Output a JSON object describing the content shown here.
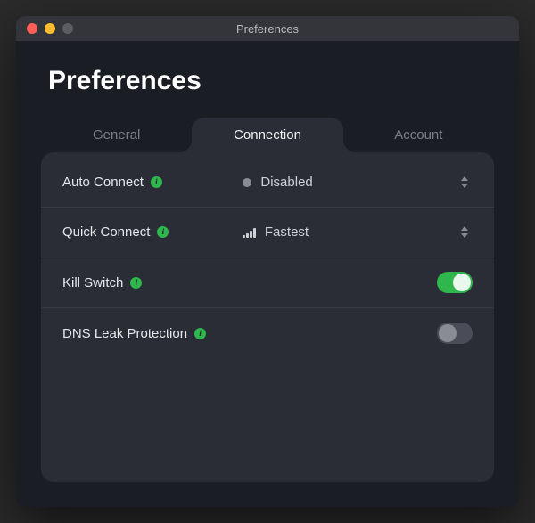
{
  "window": {
    "title": "Preferences"
  },
  "page": {
    "title": "Preferences"
  },
  "tabs": {
    "general": "General",
    "connection": "Connection",
    "account": "Account",
    "active": "connection"
  },
  "settings": {
    "auto_connect": {
      "label": "Auto Connect",
      "value": "Disabled",
      "icon": "disabled-dot"
    },
    "quick_connect": {
      "label": "Quick Connect",
      "value": "Fastest",
      "icon": "signal-bars"
    },
    "kill_switch": {
      "label": "Kill Switch",
      "state": "on"
    },
    "dns_leak": {
      "label": "DNS Leak Protection",
      "state": "off"
    }
  },
  "colors": {
    "accent_green": "#2fb64d",
    "panel_bg": "#2a2d36",
    "window_bg": "#1b1d24"
  }
}
